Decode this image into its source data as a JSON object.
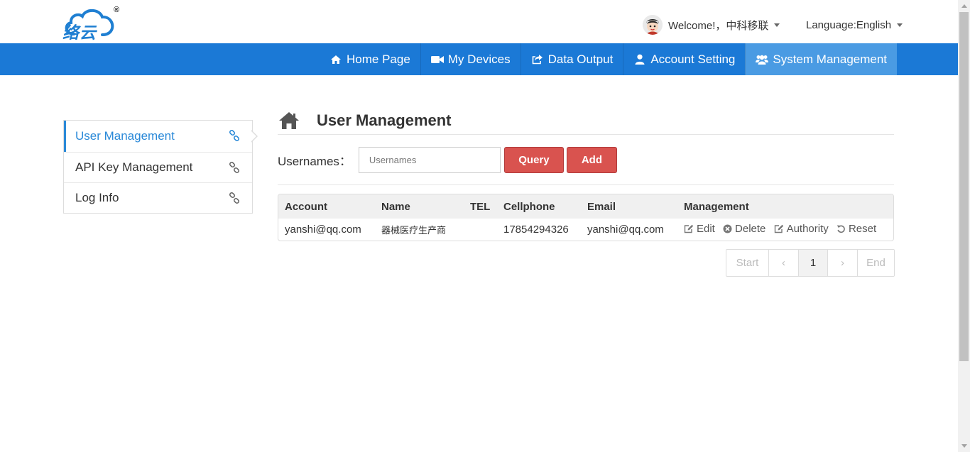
{
  "header": {
    "logo_text": "络云",
    "logo_mark": "®",
    "user_menu": {
      "label": "Welcome!，中科移联"
    },
    "language_menu": {
      "label": "Language:English"
    }
  },
  "nav": {
    "items": [
      {
        "label": "Home Page",
        "icon": "home-icon"
      },
      {
        "label": "My Devices",
        "icon": "video-camera-icon"
      },
      {
        "label": "Data Output",
        "icon": "share-export-icon"
      },
      {
        "label": "Account Setting",
        "icon": "user-icon"
      },
      {
        "label": "System Management",
        "icon": "users-group-icon",
        "active": true
      }
    ]
  },
  "sidebar": {
    "items": [
      {
        "label": "User Management",
        "icon": "link-icon",
        "active": true
      },
      {
        "label": "API Key Management",
        "icon": "link-icon"
      },
      {
        "label": "Log Info",
        "icon": "link-icon"
      }
    ]
  },
  "main": {
    "title": "User Management",
    "search": {
      "label": "Usernames：",
      "placeholder": "Usernames",
      "value": ""
    },
    "buttons": {
      "query": "Query",
      "add": "Add"
    },
    "table": {
      "columns": [
        "Account",
        "Name",
        "TEL",
        "Cellphone",
        "Email",
        "Management"
      ],
      "rows": [
        {
          "account": "yanshi@qq.com",
          "name": "器械医疗生产商",
          "tel": "",
          "cellphone": "17854294326",
          "email": "yanshi@qq.com",
          "actions": [
            "Edit",
            "Delete",
            "Authority",
            "Reset"
          ]
        }
      ]
    },
    "pagination": {
      "start": "Start",
      "prev": "‹",
      "current": "1",
      "next": "›",
      "end": "End"
    }
  },
  "colors": {
    "nav_bg": "#1b79d6",
    "nav_active": "#4a9be3",
    "accent": "#2a89d8",
    "button_red": "#d9534f"
  }
}
